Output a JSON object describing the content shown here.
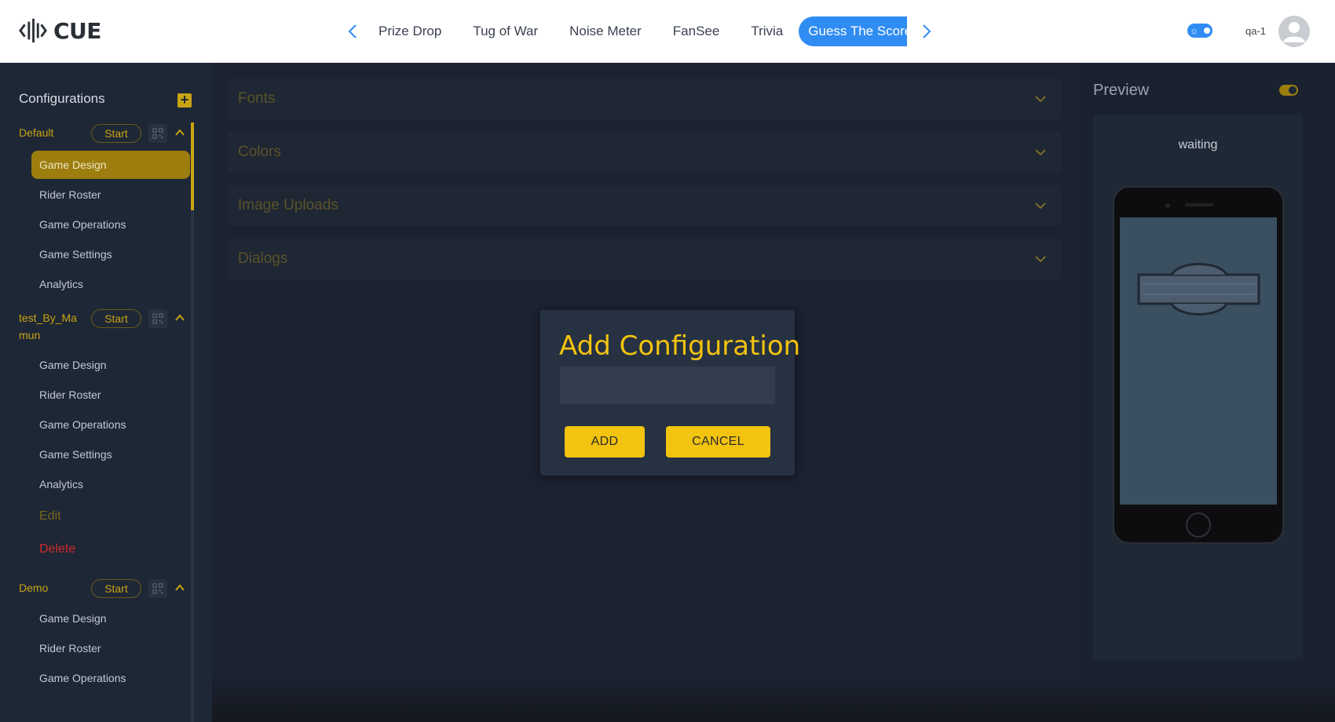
{
  "app": {
    "logo_text": "CUE"
  },
  "header": {
    "tabs": [
      {
        "label": "Prize Drop"
      },
      {
        "label": "Tug of War"
      },
      {
        "label": "Noise Meter"
      },
      {
        "label": "FanSee"
      },
      {
        "label": "Trivia"
      },
      {
        "label": "Guess The Score",
        "active": true
      }
    ],
    "username": "qa-1"
  },
  "sidebar": {
    "title": "Configurations",
    "add_symbol": "+",
    "configs": [
      {
        "name": "Default",
        "start_label": "Start",
        "items": [
          "Game Design",
          "Rider Roster",
          "Game Operations",
          "Game Settings",
          "Analytics"
        ]
      },
      {
        "name": "test_By_Mamun",
        "start_label": "Start",
        "items": [
          "Game Design",
          "Rider Roster",
          "Game Operations",
          "Game Settings",
          "Analytics"
        ],
        "edit_label": "Edit",
        "delete_label": "Delete"
      },
      {
        "name": "Demo",
        "start_label": "Start",
        "items": [
          "Game Design",
          "Rider Roster",
          "Game Operations"
        ]
      }
    ]
  },
  "main": {
    "panels": [
      {
        "title": "Fonts"
      },
      {
        "title": "Colors"
      },
      {
        "title": "Image Uploads"
      },
      {
        "title": "Dialogs"
      }
    ]
  },
  "modal": {
    "title": "Add Configuration",
    "input_value": "",
    "add_label": "ADD",
    "cancel_label": "CANCEL"
  },
  "preview": {
    "title": "Preview",
    "status": "waiting"
  },
  "colors": {
    "accent_yellow": "#f2c30f",
    "active_tab_blue": "#2f8cf2",
    "delete_red": "#d12a2a"
  }
}
